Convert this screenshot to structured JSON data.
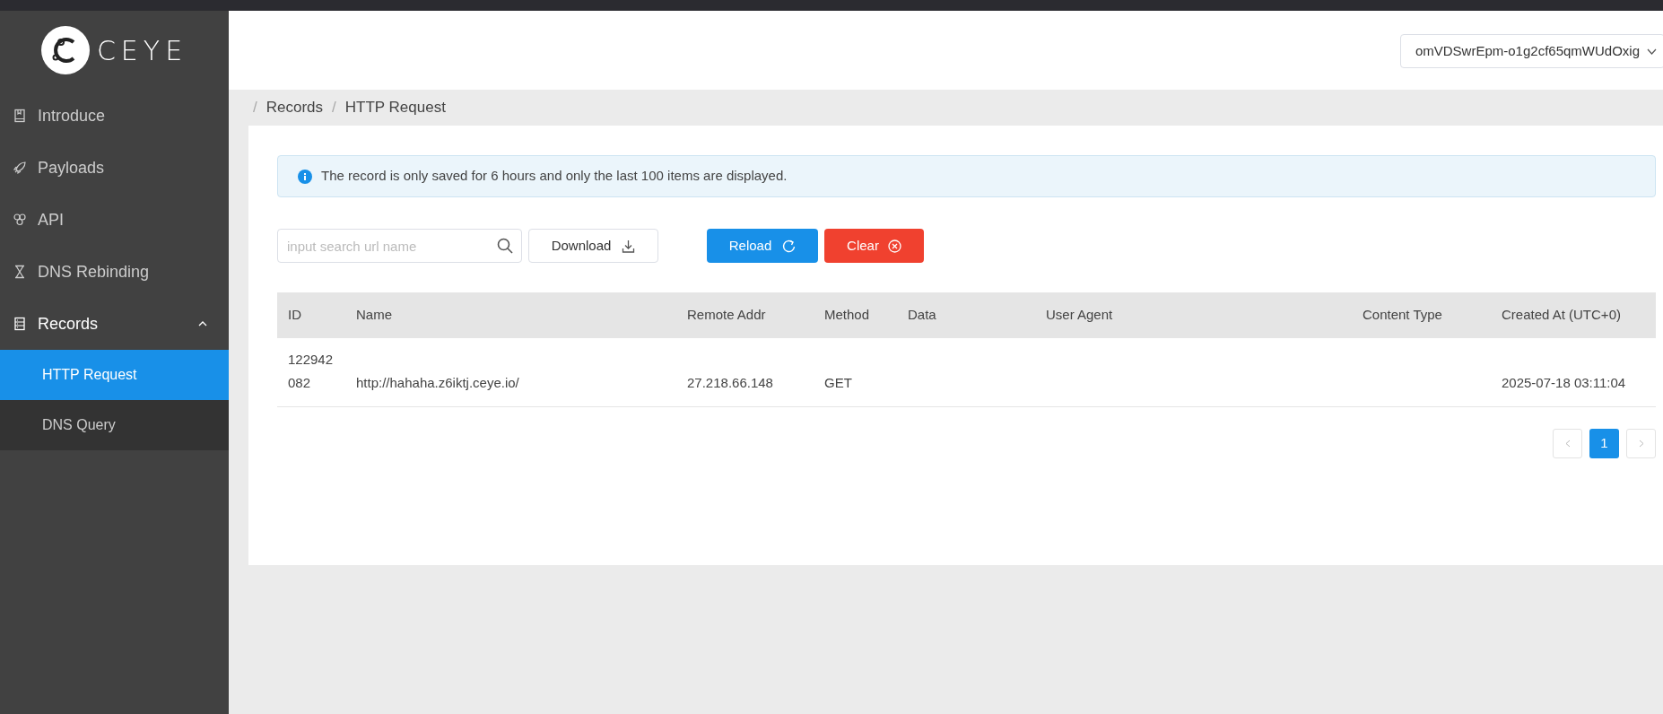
{
  "logo": {
    "text": "CEYE"
  },
  "sidebar": {
    "items": [
      {
        "label": "Introduce",
        "expanded": false
      },
      {
        "label": "Payloads",
        "expanded": false
      },
      {
        "label": "API",
        "expanded": false
      },
      {
        "label": "DNS Rebinding",
        "expanded": false
      },
      {
        "label": "Records",
        "expanded": true,
        "children": [
          {
            "label": "HTTP Request",
            "selected": true
          },
          {
            "label": "DNS Query",
            "selected": false
          }
        ]
      }
    ]
  },
  "header": {
    "identifier_select": "omVDSwrEpm-o1g2cf65qmWUdOxig"
  },
  "breadcrumb": [
    {
      "separator": "/",
      "label": "Records"
    },
    {
      "separator": "/",
      "label": "HTTP Request"
    }
  ],
  "alert": {
    "text": "The record is only saved for 6 hours and only the last 100 items are displayed."
  },
  "toolbar": {
    "search": {
      "placeholder": "input search url name"
    },
    "download": "Download",
    "reload": "Reload",
    "clear": "Clear"
  },
  "table": {
    "columns": [
      "ID",
      "Name",
      "Remote Addr",
      "Method",
      "Data",
      "User Agent",
      "Content Type",
      "Created At (UTC+0)"
    ],
    "rows": [
      [
        "122942082",
        "http://hahaha.z6iktj.ceye.io/",
        "27.218.66.148",
        "GET",
        "",
        "",
        "",
        "2025-07-18 03:11:04"
      ]
    ]
  },
  "pagination": {
    "pages": [
      {
        "label": "1",
        "selected": true
      }
    ]
  }
}
